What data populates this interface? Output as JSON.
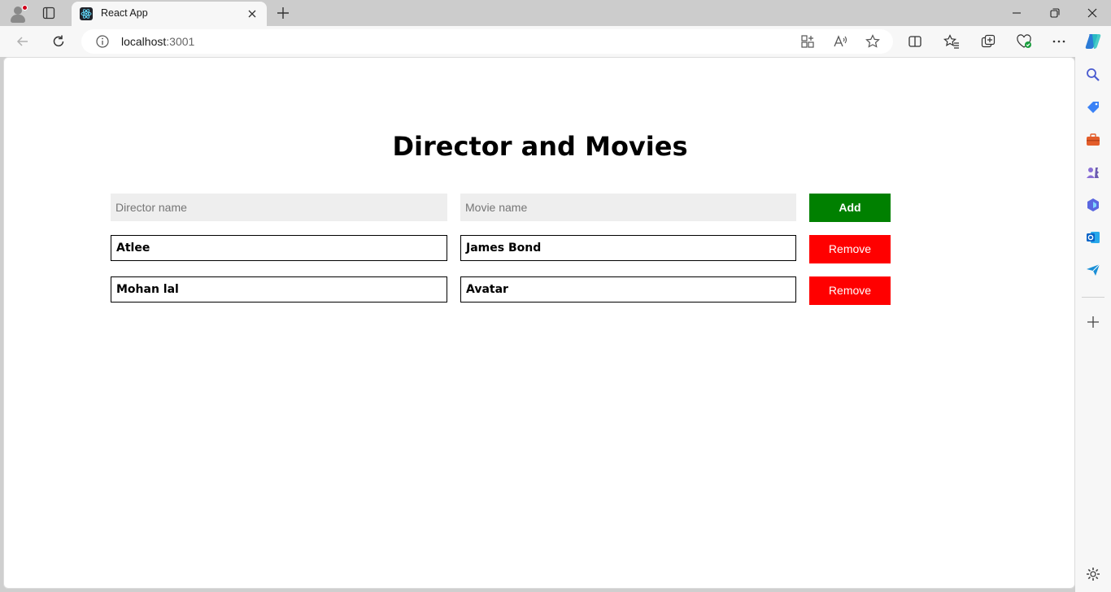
{
  "browser": {
    "tab": {
      "title": "React App"
    },
    "address": {
      "host": "localhost",
      "port": ":3001"
    }
  },
  "page": {
    "title": "Director and Movies",
    "form": {
      "director_placeholder": "Director name",
      "movie_placeholder": "Movie name",
      "add_label": "Add"
    },
    "rows": [
      {
        "director": "Atlee",
        "movie": "James Bond",
        "action": "Remove"
      },
      {
        "director": "Mohan lal",
        "movie": "Avatar",
        "action": "Remove"
      }
    ]
  },
  "colors": {
    "add": "#008000",
    "remove": "#ff0000",
    "input_bg": "#eeeeee"
  }
}
